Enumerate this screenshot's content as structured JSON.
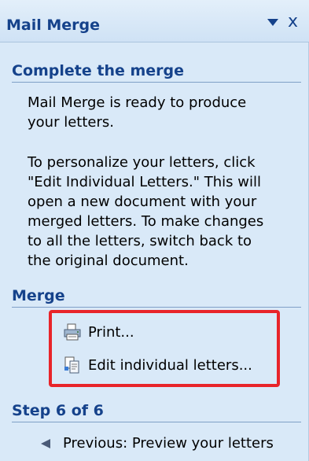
{
  "pane": {
    "title": "Mail Merge",
    "dropdown_icon": "triangle-down",
    "close_glyph": "x"
  },
  "complete": {
    "heading": "Complete the merge",
    "para1_line1": "Mail Merge is ready to produce",
    "para1_line2": "your letters.",
    "para2_line1": "To personalize your letters, click",
    "para2_line2": "\"Edit Individual Letters.\" This will",
    "para2_line3": "open a new document with your",
    "para2_line4": "merged letters. To make changes",
    "para2_line5": "to all the letters, switch back to",
    "para2_line6": "the original document."
  },
  "merge": {
    "heading": "Merge",
    "print_label": "Print...",
    "edit_label": "Edit individual letters..."
  },
  "step": {
    "heading": "Step 6 of 6",
    "previous_label": "Previous: Preview your letters"
  },
  "colors": {
    "pane_bg": "#d9e9f8",
    "heading_blue": "#15428b",
    "highlight_red": "#e8242a"
  }
}
